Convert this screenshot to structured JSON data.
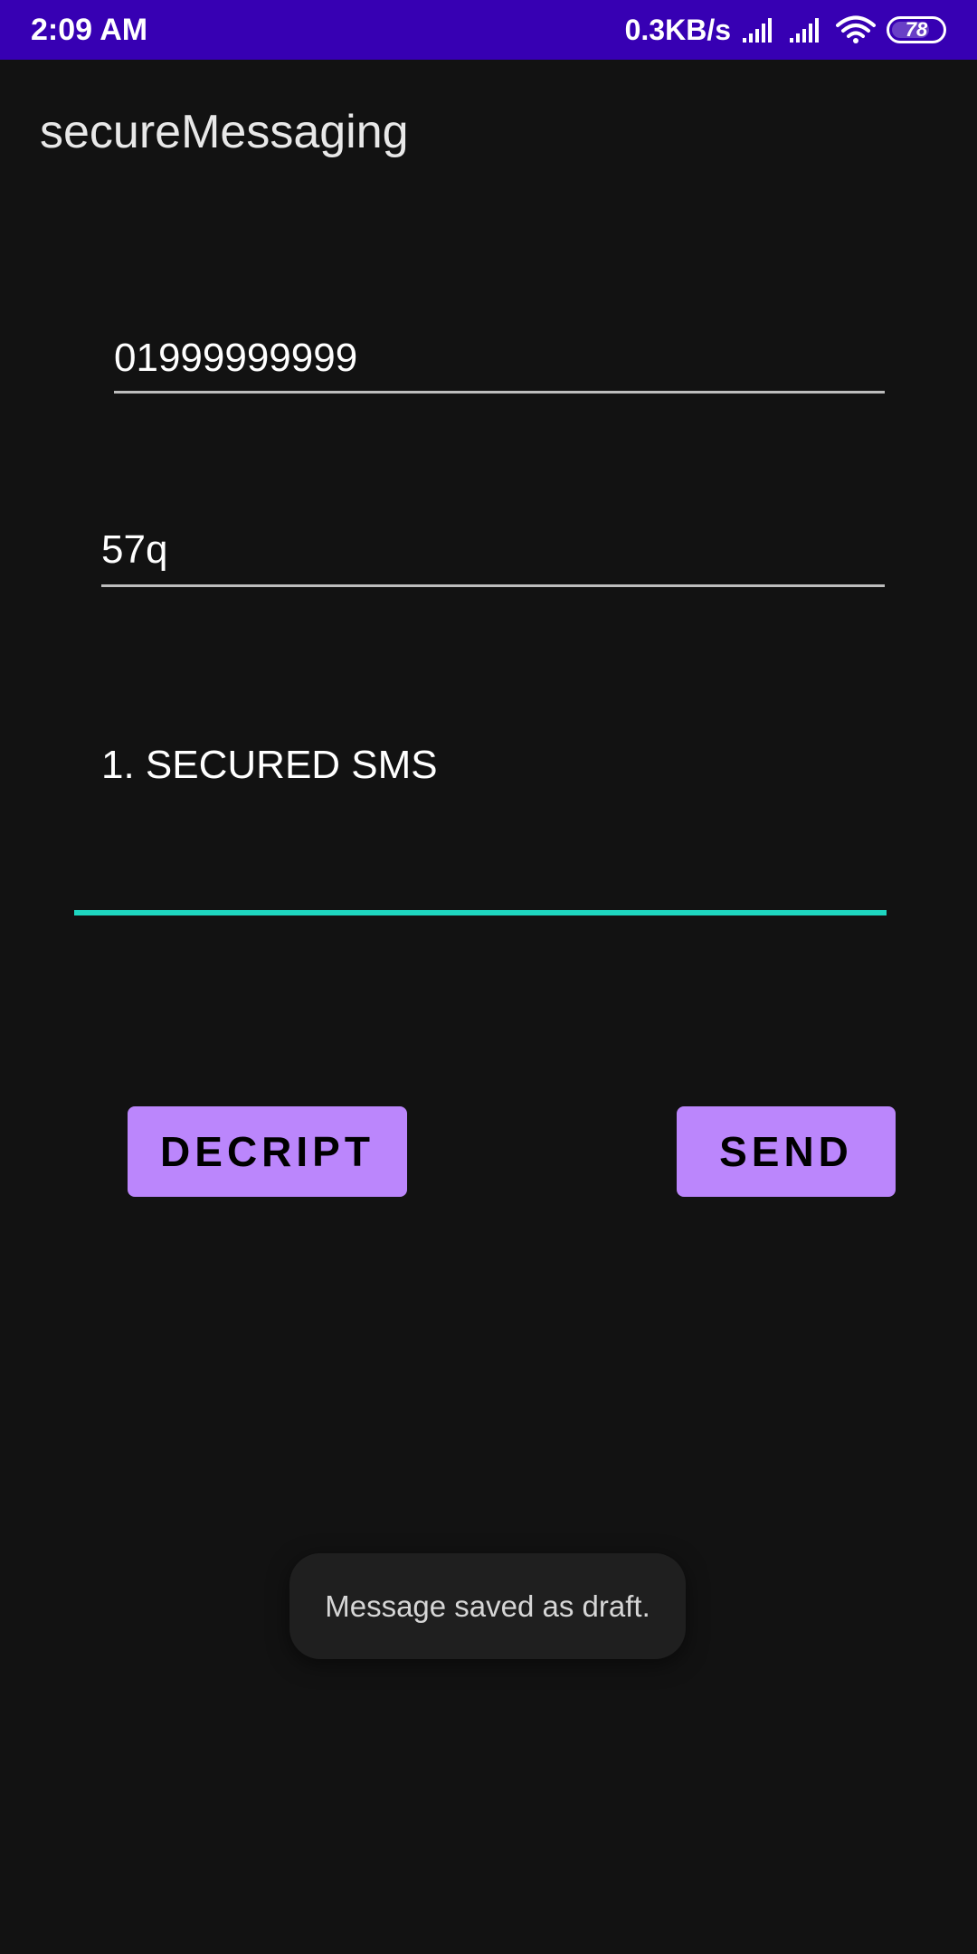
{
  "status_bar": {
    "time": "2:09 AM",
    "net_speed": "0.3KB/s",
    "battery_level": "78",
    "battery_fraction": 0.78,
    "icons": [
      "signal-icon",
      "signal-icon",
      "wifi-icon",
      "battery-icon"
    ]
  },
  "app": {
    "title": "secureMessaging"
  },
  "form": {
    "phone_value": "01999999999",
    "key_value": "57q",
    "message_value": "1. SECURED SMS"
  },
  "buttons": {
    "decript_label": "DECRIPT",
    "send_label": "SEND"
  },
  "toast": {
    "text": "Message saved as draft."
  },
  "colors": {
    "status_bar": "#3700b3",
    "background": "#121212",
    "button": "#bb86fc",
    "focus_underline": "#1ed6c0"
  }
}
